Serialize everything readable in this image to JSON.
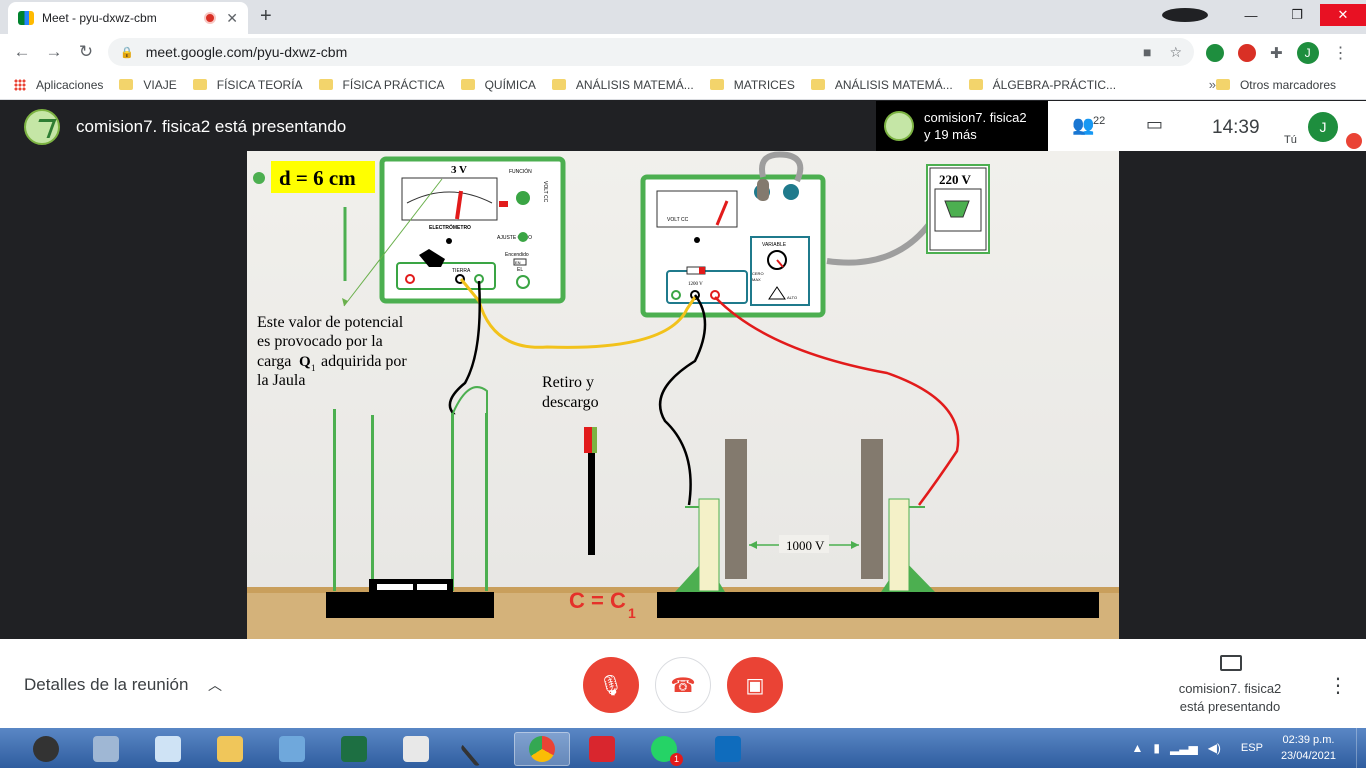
{
  "browser": {
    "tab_title": "Meet - pyu-dxwz-cbm",
    "url": "meet.google.com/pyu-dxwz-cbm",
    "bookmarks": [
      "Aplicaciones",
      "VIAJE",
      "FÍSICA TEORÍA",
      "FÍSICA PRÁCTICA",
      "QUÍMICA",
      "ANÁLISIS MATEMÁ...",
      "MATRICES",
      "ANÁLISIS MATEMÁ...",
      "ÁLGEBRA-PRÁCTIC..."
    ],
    "bookmarks_more": "»",
    "other_bookmarks": "Otros marcadores",
    "profile_initial": "J"
  },
  "meet": {
    "presenting_title": "comision7. fisica2 está presentando",
    "chip_line1": "comision7. fisica2",
    "chip_line2": "y 19 más",
    "people_count": "22",
    "time": "14:39",
    "self_initial": "J",
    "self_label": "Tú",
    "details_label": "Detalles de la reunión",
    "presenting_line1": "comision7. fisica2",
    "presenting_line2": "está presentando"
  },
  "slide": {
    "distance_label": "d = 6 cm",
    "electrometer_range": "3 V",
    "electrometer_name": "ELECTRÓMETRO",
    "funcion": "FUNCIÓN",
    "volt_cc": "VOLT CC",
    "ajuste_cero": "AJUSTE CERO",
    "encendido": "Encendido",
    "en": "EN",
    "el": "EL",
    "tierra": "TIERRA",
    "supply_range": "220 V",
    "volt_cc_label": "VOLT CC",
    "variable": "VARIABLE",
    "cero": "CERO",
    "max": "MAX",
    "alto": "ALTO",
    "supply_voltage": "1200 V",
    "explanation": [
      "Este valor de potencial",
      "es provocado por la",
      "carga",
      "Q",
      "1",
      "adquirida por",
      "la Jaula"
    ],
    "retiro": [
      "Retiro y",
      "descargo"
    ],
    "plate_voltage": "1000 V",
    "equation_main": "C = C",
    "equation_sub": "1",
    "colors": {
      "green_frame": "#4caf50",
      "plate": "#837a6e",
      "stand": "#f4f1c8",
      "base": "#000000",
      "equation": "#e5312a",
      "yellow_wire": "#f2c21b",
      "red_wire": "#e21b1b"
    }
  },
  "taskbar": {
    "lang": "ESP",
    "time": "02:39 p.m.",
    "date": "23/04/2021",
    "whatsapp_badge": "1"
  }
}
